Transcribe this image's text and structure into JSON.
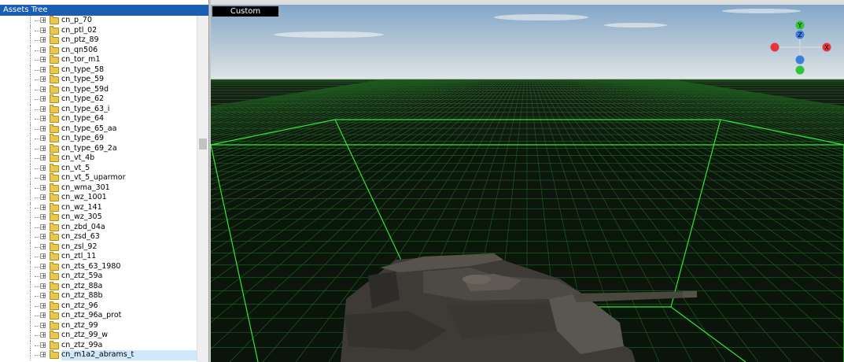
{
  "panel": {
    "title": "Assets Tree",
    "items": [
      {
        "label": "cn_p_70"
      },
      {
        "label": "cn_ptl_02"
      },
      {
        "label": "cn_ptz_89"
      },
      {
        "label": "cn_qn506"
      },
      {
        "label": "cn_tor_m1"
      },
      {
        "label": "cn_type_58"
      },
      {
        "label": "cn_type_59"
      },
      {
        "label": "cn_type_59d"
      },
      {
        "label": "cn_type_62"
      },
      {
        "label": "cn_type_63_i"
      },
      {
        "label": "cn_type_64"
      },
      {
        "label": "cn_type_65_aa"
      },
      {
        "label": "cn_type_69"
      },
      {
        "label": "cn_type_69_2a"
      },
      {
        "label": "cn_vt_4b"
      },
      {
        "label": "cn_vt_5"
      },
      {
        "label": "cn_vt_5_uparmor"
      },
      {
        "label": "cn_wma_301"
      },
      {
        "label": "cn_wz_1001"
      },
      {
        "label": "cn_wz_141"
      },
      {
        "label": "cn_wz_305"
      },
      {
        "label": "cn_zbd_04a"
      },
      {
        "label": "cn_zsd_63"
      },
      {
        "label": "cn_zsl_92"
      },
      {
        "label": "cn_ztl_11"
      },
      {
        "label": "cn_zts_63_1980"
      },
      {
        "label": "cn_ztz_59a"
      },
      {
        "label": "cn_ztz_88a"
      },
      {
        "label": "cn_ztz_88b"
      },
      {
        "label": "cn_ztz_96"
      },
      {
        "label": "cn_ztz_96a_prot"
      },
      {
        "label": "cn_ztz_99"
      },
      {
        "label": "cn_ztz_99_w"
      },
      {
        "label": "cn_ztz_99a"
      },
      {
        "label": "cn_m1a2_abrams_t",
        "selected": true
      }
    ],
    "expander_symbol": "+"
  },
  "viewport": {
    "mode_tab": "Custom",
    "gizmo": {
      "y_label": "Y",
      "x_label": "X",
      "z_label": "Z"
    },
    "colors": {
      "sky_top": "#7da3c6",
      "sky_bottom": "#d9e0e4",
      "ground": "#0b160b",
      "grid": "#1f5a1f",
      "bounds": "#33e633"
    }
  }
}
